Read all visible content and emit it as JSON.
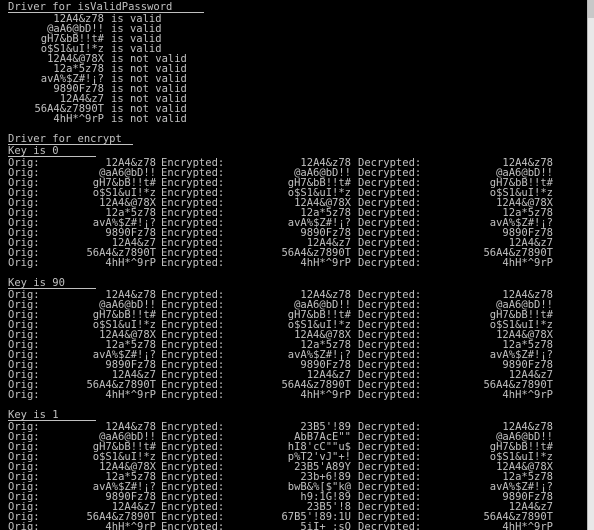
{
  "validation_section": {
    "header": "Driver for isValidPassword",
    "rows": [
      {
        "password": "12A4&z78",
        "result": "is valid"
      },
      {
        "password": "@aA6@bD!!",
        "result": "is valid"
      },
      {
        "password": "gH7&bB!!t#",
        "result": "is valid"
      },
      {
        "password": "o$S1&uI!*z",
        "result": "is valid"
      },
      {
        "password": "12A4&@78X",
        "result": "is not valid"
      },
      {
        "password": "12a*5z78",
        "result": "is not valid"
      },
      {
        "password": "avA%$Z#!¡?",
        "result": "is not valid"
      },
      {
        "password": "9890Fz78",
        "result": "is not valid"
      },
      {
        "password": "12A4&z7",
        "result": "is not valid"
      },
      {
        "password": "56A4&z7890T",
        "result": "is not valid"
      },
      {
        "password": "4hH*^9rP",
        "result": "is not valid"
      }
    ]
  },
  "encrypt_section": {
    "header": "Driver for encrypt",
    "labels": {
      "orig": "Orig:",
      "encrypted": "Encrypted:",
      "decrypted": "Decrypted:"
    },
    "blocks": [
      {
        "key_label": "Key is 0",
        "rows": [
          {
            "orig": "12A4&z78",
            "enc": "12A4&z78",
            "dec": "12A4&z78"
          },
          {
            "orig": "@aA6@bD!!",
            "enc": "@aA6@bD!!",
            "dec": "@aA6@bD!!"
          },
          {
            "orig": "gH7&bB!!t#",
            "enc": "gH7&bB!!t#",
            "dec": "gH7&bB!!t#"
          },
          {
            "orig": "o$S1&uI!*z",
            "enc": "o$S1&uI!*z",
            "dec": "o$S1&uI!*z"
          },
          {
            "orig": "12A4&@78X",
            "enc": "12A4&@78X",
            "dec": "12A4&@78X"
          },
          {
            "orig": "12a*5z78",
            "enc": "12a*5z78",
            "dec": "12a*5z78"
          },
          {
            "orig": "avA%$Z#!¡?",
            "enc": "avA%$Z#!¡?",
            "dec": "avA%$Z#!¡?"
          },
          {
            "orig": "9890Fz78",
            "enc": "9890Fz78",
            "dec": "9890Fz78"
          },
          {
            "orig": "12A4&z7",
            "enc": "12A4&z7",
            "dec": "12A4&z7"
          },
          {
            "orig": "56A4&z7890T",
            "enc": "56A4&z7890T",
            "dec": "56A4&z7890T"
          },
          {
            "orig": "4hH*^9rP",
            "enc": "4hH*^9rP",
            "dec": "4hH*^9rP"
          }
        ]
      },
      {
        "key_label": "Key is 90",
        "rows": [
          {
            "orig": "12A4&z78",
            "enc": "12A4&z78",
            "dec": "12A4&z78"
          },
          {
            "orig": "@aA6@bD!!",
            "enc": "@aA6@bD!!",
            "dec": "@aA6@bD!!"
          },
          {
            "orig": "gH7&bB!!t#",
            "enc": "gH7&bB!!t#",
            "dec": "gH7&bB!!t#"
          },
          {
            "orig": "o$S1&uI!*z",
            "enc": "o$S1&uI!*z",
            "dec": "o$S1&uI!*z"
          },
          {
            "orig": "12A4&@78X",
            "enc": "12A4&@78X",
            "dec": "12A4&@78X"
          },
          {
            "orig": "12a*5z78",
            "enc": "12a*5z78",
            "dec": "12a*5z78"
          },
          {
            "orig": "avA%$Z#!¡?",
            "enc": "avA%$Z#!¡?",
            "dec": "avA%$Z#!¡?"
          },
          {
            "orig": "9890Fz78",
            "enc": "9890Fz78",
            "dec": "9890Fz78"
          },
          {
            "orig": "12A4&z7",
            "enc": "12A4&z7",
            "dec": "12A4&z7"
          },
          {
            "orig": "56A4&z7890T",
            "enc": "56A4&z7890T",
            "dec": "56A4&z7890T"
          },
          {
            "orig": "4hH*^9rP",
            "enc": "4hH*^9rP",
            "dec": "4hH*^9rP"
          }
        ]
      },
      {
        "key_label": "Key is 1",
        "rows": [
          {
            "orig": "12A4&z78",
            "enc": "23B5'!89",
            "dec": "12A4&z78"
          },
          {
            "orig": "@aA6@bD!!",
            "enc": "AbB7AcE\"\"",
            "dec": "@aA6@bD!!"
          },
          {
            "orig": "gH7&bB!!t#",
            "enc": "hI8'cC\"\"u$",
            "dec": "gH7&bB!!t#"
          },
          {
            "orig": "o$S1&uI!*z",
            "enc": "p%T2'vJ\"+!",
            "dec": "o$S1&uI!*z"
          },
          {
            "orig": "12A4&@78X",
            "enc": "23B5'A89Y",
            "dec": "12A4&@78X"
          },
          {
            "orig": "12a*5z78",
            "enc": "23b+6!89",
            "dec": "12a*5z78"
          },
          {
            "orig": "avA%$Z#!¡?",
            "enc": "bwB&%[$\"k@",
            "dec": "avA%$Z#!¡?"
          },
          {
            "orig": "9890Fz78",
            "enc": "h9:1G!89",
            "dec": "9890Fz78"
          },
          {
            "orig": "12A4&z7",
            "enc": "23B5'!8",
            "dec": "12A4&z7"
          },
          {
            "orig": "56A4&z7890T",
            "enc": "67B5'!89:1U",
            "dec": "56A4&z7890T"
          },
          {
            "orig": "4hH*^9rP",
            "enc": "5iI+_:sQ",
            "dec": "4hH*^9rP"
          }
        ]
      }
    ]
  }
}
